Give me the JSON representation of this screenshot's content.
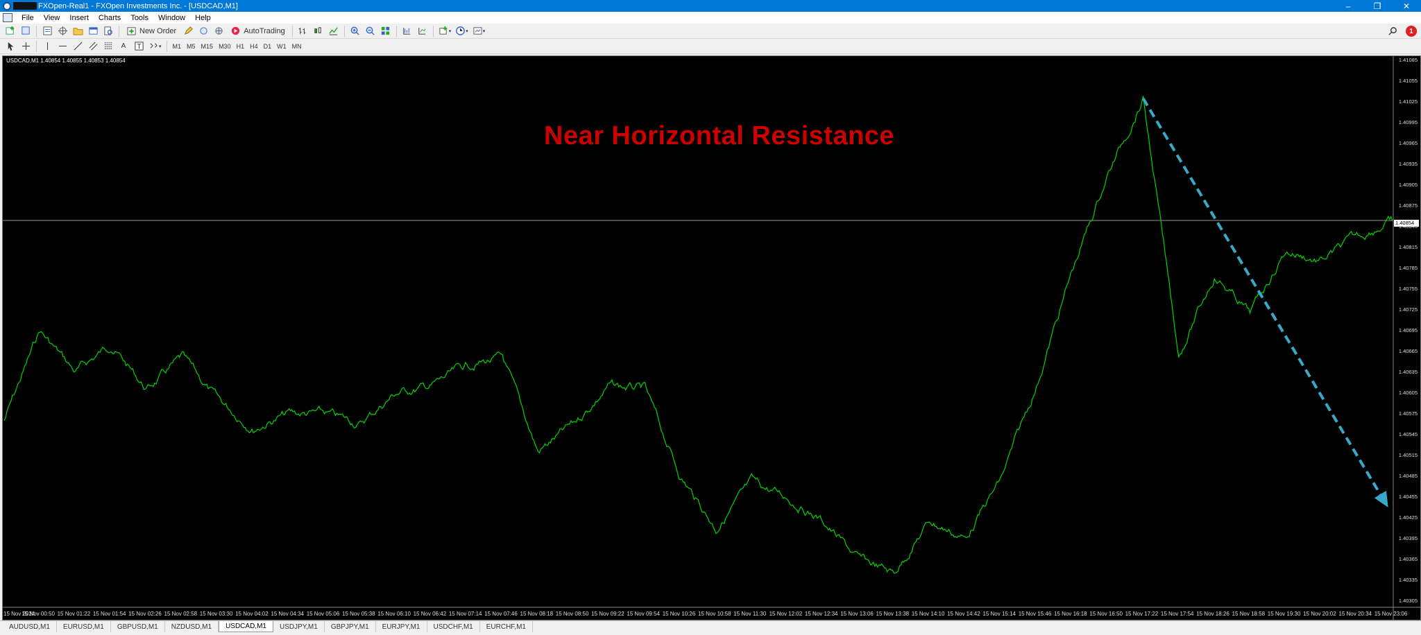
{
  "window": {
    "title": "FXOpen-Real1 - FXOpen Investments Inc. - [USDCAD,M1]",
    "controls": [
      "–",
      "❐",
      "✕"
    ]
  },
  "menu": [
    "File",
    "View",
    "Insert",
    "Charts",
    "Tools",
    "Window",
    "Help"
  ],
  "toolbar": {
    "new_order": "New Order",
    "auto_trading": "AutoTrading",
    "timeframes": [
      "M1",
      "M5",
      "M15",
      "M30",
      "H1",
      "H4",
      "D1",
      "W1",
      "MN"
    ],
    "notification_count": "1"
  },
  "chart": {
    "header": "USDCAD,M1  1.40854 1.40855 1.40853 1.40854",
    "annotation": "Near Horizontal Resistance",
    "current_price": "1.40854",
    "colors": {
      "background": "#000000",
      "line": "#00d400",
      "annotation": "#cc0000",
      "arrow": "#3aa8c8"
    }
  },
  "chart_data": {
    "type": "line",
    "symbol": "USDCAD",
    "timeframe": "M1",
    "price_ticks": [
      "1.41085",
      "1.41055",
      "1.41025",
      "1.40995",
      "1.40965",
      "1.40935",
      "1.40905",
      "1.40875",
      "1.40845",
      "1.40815",
      "1.40785",
      "1.40755",
      "1.40725",
      "1.40695",
      "1.40665",
      "1.40635",
      "1.40605",
      "1.40575",
      "1.40545",
      "1.40515",
      "1.40485",
      "1.40455",
      "1.40425",
      "1.40395",
      "1.40365",
      "1.40335",
      "1.40305"
    ],
    "time_ticks": [
      "15 Nov 2024",
      "15 Nov 00:50",
      "15 Nov 01:22",
      "15 Nov 01:54",
      "15 Nov 02:26",
      "15 Nov 02:58",
      "15 Nov 03:30",
      "15 Nov 04:02",
      "15 Nov 04:34",
      "15 Nov 05:06",
      "15 Nov 05:38",
      "15 Nov 06:10",
      "15 Nov 06:42",
      "15 Nov 07:14",
      "15 Nov 07:46",
      "15 Nov 08:18",
      "15 Nov 08:50",
      "15 Nov 09:22",
      "15 Nov 09:54",
      "15 Nov 10:26",
      "15 Nov 10:58",
      "15 Nov 11:30",
      "15 Nov 12:02",
      "15 Nov 12:34",
      "15 Nov 13:06",
      "15 Nov 13:38",
      "15 Nov 14:10",
      "15 Nov 14:42",
      "15 Nov 15:14",
      "15 Nov 15:46",
      "15 Nov 16:18",
      "15 Nov 16:50",
      "15 Nov 17:22",
      "15 Nov 17:54",
      "15 Nov 18:26",
      "15 Nov 18:58",
      "15 Nov 19:30",
      "15 Nov 20:02",
      "15 Nov 20:34",
      "15 Nov 23:06"
    ],
    "ylim": [
      1.40305,
      1.41085
    ],
    "x": [
      "00:18",
      "00:50",
      "01:22",
      "01:54",
      "02:26",
      "02:58",
      "03:30",
      "04:02",
      "04:34",
      "05:06",
      "05:38",
      "06:10",
      "06:42",
      "07:14",
      "07:46",
      "08:18",
      "08:50",
      "09:22",
      "09:54",
      "10:26",
      "10:58",
      "11:30",
      "12:02",
      "12:34",
      "13:06",
      "13:38",
      "14:10",
      "14:42",
      "15:14",
      "15:46",
      "16:18",
      "16:50",
      "17:22",
      "17:54",
      "18:26",
      "18:58",
      "19:30",
      "20:02",
      "20:34",
      "23:06"
    ],
    "series": [
      {
        "values": [
          1.40565,
          1.40695,
          1.40635,
          1.40675,
          1.4061,
          1.40655,
          1.40595,
          1.40555,
          1.40575,
          1.40575,
          1.4056,
          1.40605,
          1.40615,
          1.40645,
          1.40655,
          1.4052,
          1.4056,
          1.40615,
          1.4061,
          1.40485,
          1.4041,
          1.40475,
          1.40455,
          1.4042,
          1.40365,
          1.40345,
          1.4042,
          1.40395,
          1.4048,
          1.40615,
          1.4078,
          1.4092,
          1.4103,
          1.4066,
          1.40775,
          1.4072,
          1.4081,
          1.40795,
          1.4083,
          1.40854
        ]
      }
    ],
    "arrow": {
      "from": {
        "time": "17:22",
        "price": 1.4103
      },
      "to": {
        "time": "23:06",
        "price": 1.4044
      },
      "style": "dashed"
    },
    "horizontal_line": 1.40854,
    "grid": false
  },
  "tabs": [
    "AUDUSD,M1",
    "EURUSD,M1",
    "GBPUSD,M1",
    "NZDUSD,M1",
    "USDCAD,M1",
    "USDJPY,M1",
    "GBPJPY,M1",
    "EURJPY,M1",
    "USDCHF,M1",
    "EURCHF,M1"
  ],
  "active_tab": "USDCAD,M1"
}
